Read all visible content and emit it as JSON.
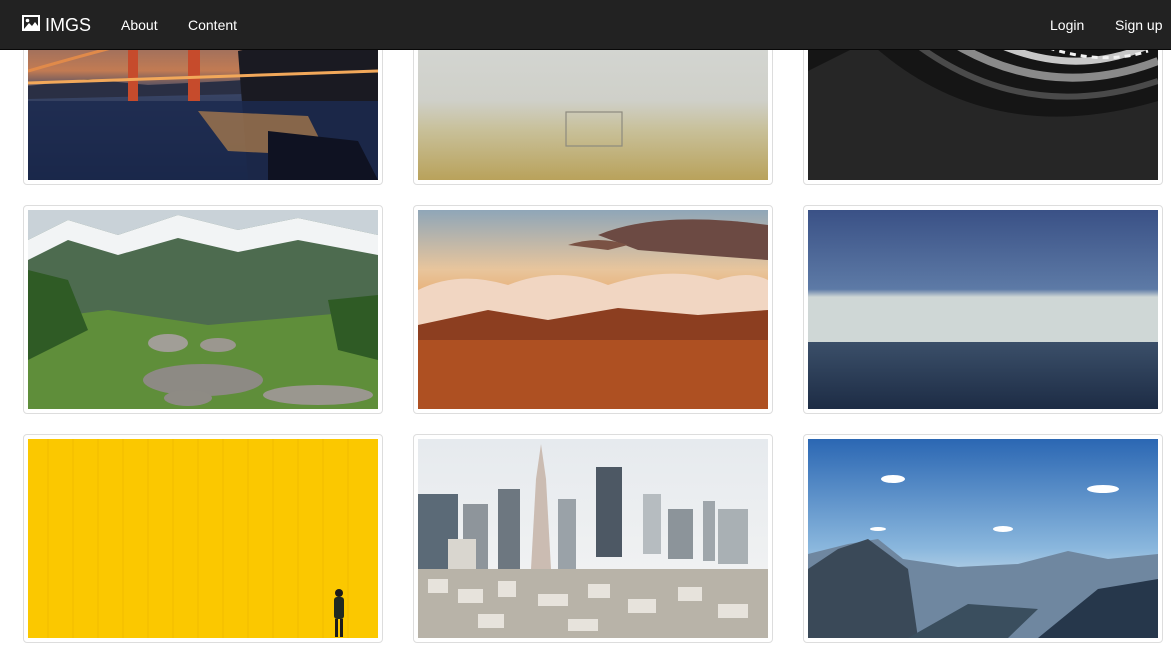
{
  "navbar": {
    "brand": "IMGS",
    "brand_icon": "image-icon",
    "about": "About",
    "content": "Content",
    "login": "Login",
    "signup": "Sign up",
    "background": "#222222"
  },
  "gallery": {
    "images": [
      {
        "subject": "golden-gate-bridge-at-dusk"
      },
      {
        "subject": "foggy-field-with-frame"
      },
      {
        "subject": "black-abstract-architecture"
      },
      {
        "subject": "snowy-mountains-green-meadow"
      },
      {
        "subject": "sunset-clouds-over-mountains"
      },
      {
        "subject": "calm-ocean-horizon"
      },
      {
        "subject": "yellow-wall-with-person"
      },
      {
        "subject": "city-skyline-pyramid-tower"
      },
      {
        "subject": "mountain-valley-blue-sky"
      }
    ]
  }
}
